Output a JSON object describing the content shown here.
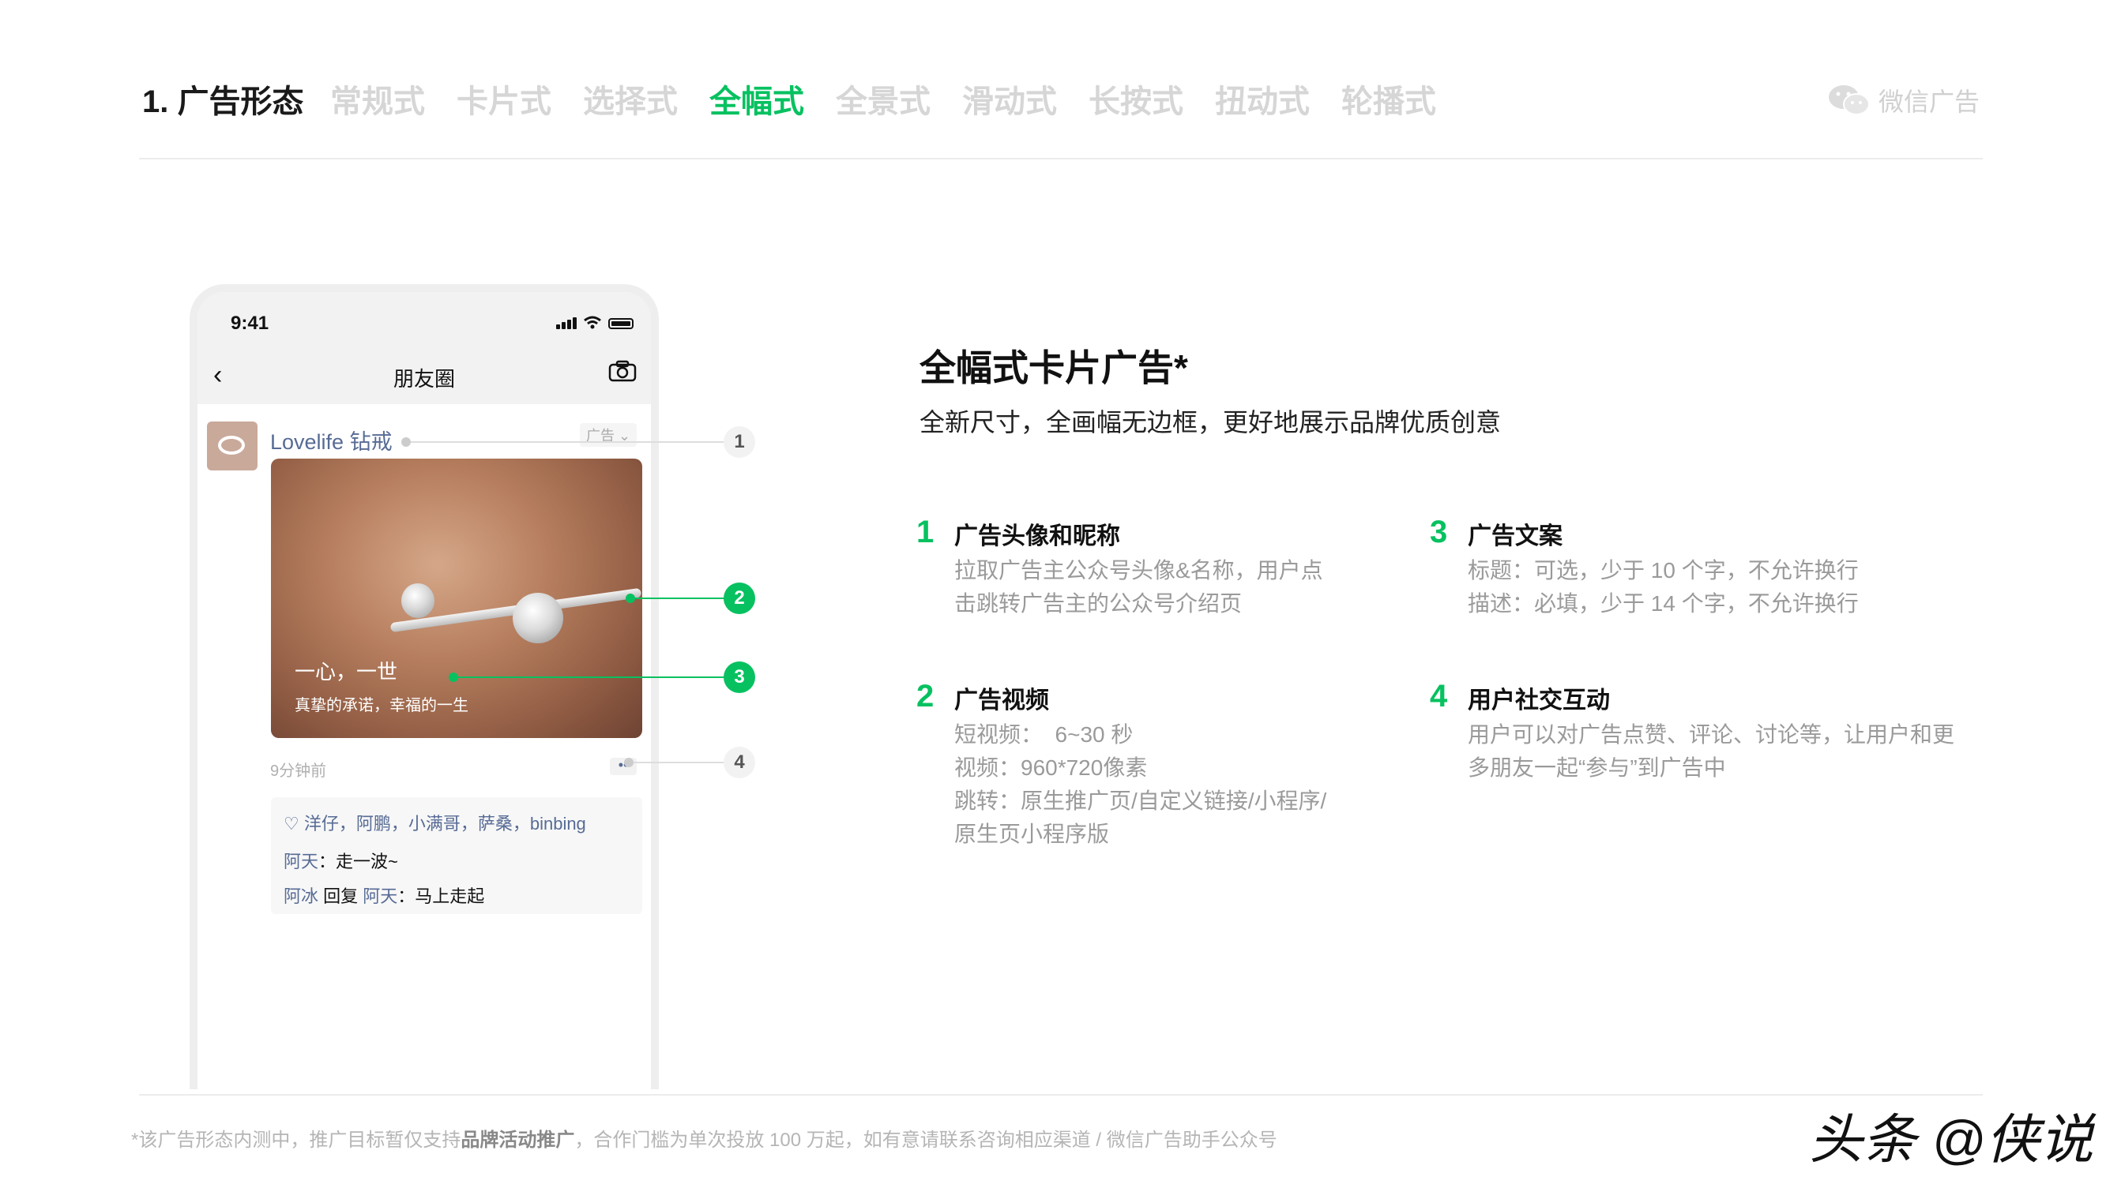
{
  "header": {
    "section_title": "1. 广告形态",
    "tabs": [
      {
        "label": "常规式",
        "active": false
      },
      {
        "label": "卡片式",
        "active": false
      },
      {
        "label": "选择式",
        "active": false
      },
      {
        "label": "全幅式",
        "active": true
      },
      {
        "label": "全景式",
        "active": false
      },
      {
        "label": "滑动式",
        "active": false
      },
      {
        "label": "长按式",
        "active": false
      },
      {
        "label": "扭动式",
        "active": false
      },
      {
        "label": "轮播式",
        "active": false
      }
    ],
    "brand_label": "微信广告",
    "brand_icon": "wechat-icon",
    "accent_color": "#07c160"
  },
  "phone": {
    "time": "9:41",
    "nav_title": "朋友圈",
    "nav_back_icon": "chevron-left-icon",
    "nav_camera_icon": "camera-icon",
    "post": {
      "nickname": "Lovelife 钻戒",
      "ad_tag": "广告 ⌄",
      "image_headline": "一心，一世",
      "image_desc": "真挚的承诺，幸福的一生",
      "time_ago": "9分钟前",
      "more": "••",
      "likes": "洋仔，阿鹏，小满哥，萨桑，binbing",
      "comments": [
        {
          "user": "阿天",
          "text": "：走一波~"
        },
        {
          "user": "阿冰",
          "reply_word": " 回复 ",
          "reply_to": "阿天",
          "text": "：马上走起"
        }
      ]
    }
  },
  "callouts": [
    "1",
    "2",
    "3",
    "4"
  ],
  "content": {
    "title": "全幅式卡片广告*",
    "subtitle": "全新尺寸，全画幅无边框，更好地展示品牌优质创意",
    "features": [
      {
        "num": "1",
        "title": "广告头像和昵称",
        "lines": [
          "拉取广告主公众号头像&名称，用户点",
          "击跳转广告主的公众号介绍页"
        ]
      },
      {
        "num": "2",
        "title": "广告视频",
        "lines": [
          "短视频：  6~30 秒",
          "视频：960*720像素",
          "跳转：原生推广页/自定义链接/小程序/",
          "原生页小程序版"
        ]
      },
      {
        "num": "3",
        "title": "广告文案",
        "lines": [
          "标题：可选，少于 10 个字，不允许换行",
          "描述：必填，少于 14 个字，不允许换行"
        ]
      },
      {
        "num": "4",
        "title": "用户社交互动",
        "lines": [
          "用户可以对广告点赞、评论、讨论等，让用户和更",
          "多朋友一起“参与”到广告中"
        ]
      }
    ]
  },
  "footer": {
    "note_before": "*该广告形态内测中，推广目标暂仅支持",
    "note_bold": "品牌活动推广",
    "note_after": "，合作门槛为单次投放 100 万起，如有意请联系咨询相应渠道 / 微信广告助手公众号",
    "watermark": "头条 @侠说"
  }
}
